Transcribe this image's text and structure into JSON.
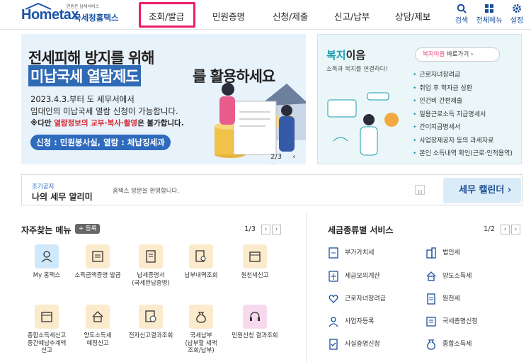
{
  "header": {
    "logo_sub": "민원은 납세서비스",
    "logo_main": "Hometax",
    "logo_kr": "국세청홈택스",
    "nav": [
      "조회/발급",
      "민원증명",
      "신청/제출",
      "신고/납부",
      "상담/제보"
    ],
    "active_nav": "조회/발급",
    "utils": [
      "검색",
      "전체메뉴",
      "설정"
    ]
  },
  "banner": {
    "title1": "전세피해 방지를 위해",
    "title2a": "미납국세 열람제도",
    "title2b": "를 활용하세요",
    "desc1": "2023.4.3.부터 도 세무서에서",
    "desc2": "임대인의 미납국세 열람 신청이 가능합니다.",
    "desc3_prefix": "※다만 ",
    "desc3_red": "열람정보의 교부·복사·촬영",
    "desc3_suffix": "은 불가합니다.",
    "pill": "신청 : 민원봉사실, 열람 : 체납징세과",
    "pager": "2/3"
  },
  "welfare": {
    "title_hl": "복지",
    "title": "이음",
    "sub": "소득과 복지를 연결하다!",
    "btn_hl": "복지이음",
    "btn": " 바로가기",
    "items": [
      "근로자녀장려금",
      "취업 후 학자금 상환",
      "인건비 간편제출",
      "일용근로소득 지급명세서",
      "간이지급명세서",
      "사업장제공자 등의 과세자료",
      "본인 소득내역 확인(근로·인적용역)"
    ]
  },
  "notice": {
    "small": "조기공지",
    "large": "나의 세무 알리미",
    "text": "홈택스 방문을 환영합니다.",
    "calendar": "세무 캘린더"
  },
  "favorites": {
    "title": "자주찾는 메뉴",
    "register": "등록",
    "page": "1/3",
    "items": [
      {
        "label": "My 홈택스",
        "icon": "person-icon",
        "color": "blue"
      },
      {
        "label": "소득금액증명 발급",
        "icon": "certificate-icon",
        "color": "orange"
      },
      {
        "label": "납세증명서\n(국세완납증명)",
        "icon": "document-icon",
        "color": "orange"
      },
      {
        "label": "납부내역조회",
        "icon": "receipt-search-icon",
        "color": "orange"
      },
      {
        "label": "원천세신고",
        "icon": "calendar-icon",
        "color": "orange"
      },
      {
        "label": "종합소득세신고\n중간예납추계액\n신고",
        "icon": "calendar-icon",
        "color": "orange"
      },
      {
        "label": "양도소득세\n예정신고",
        "icon": "house-icon",
        "color": "orange"
      },
      {
        "label": "전자신고결과조회",
        "icon": "won-document-icon",
        "color": "orange"
      },
      {
        "label": "국세납부\n(납부할 세액\n조회/납부)",
        "icon": "money-bag-icon",
        "color": "orange"
      },
      {
        "label": "민원신청 결과조회",
        "icon": "headset-icon",
        "color": "pink"
      }
    ]
  },
  "tax_services": {
    "title": "세금종류별 서비스",
    "page": "1/2",
    "items": [
      {
        "label": "부가가치세",
        "icon": "vat-icon"
      },
      {
        "label": "법인세",
        "icon": "building-icon"
      },
      {
        "label": "세금모의계산",
        "icon": "calculator-icon"
      },
      {
        "label": "양도소득세",
        "icon": "house-icon"
      },
      {
        "label": "근로자녀장려금",
        "icon": "heart-hand-icon"
      },
      {
        "label": "원천세",
        "icon": "document-icon"
      },
      {
        "label": "사업자등록",
        "icon": "person-icon"
      },
      {
        "label": "국세증명신청",
        "icon": "certificate-icon"
      },
      {
        "label": "사실증명신청",
        "icon": "check-document-icon"
      },
      {
        "label": "종합소득세",
        "icon": "money-bag-icon"
      }
    ]
  },
  "colors": {
    "brand": "#1a54a7",
    "active": "#ec1d6c",
    "accent": "#2e6bbd",
    "welfare": "#1a9db1"
  }
}
